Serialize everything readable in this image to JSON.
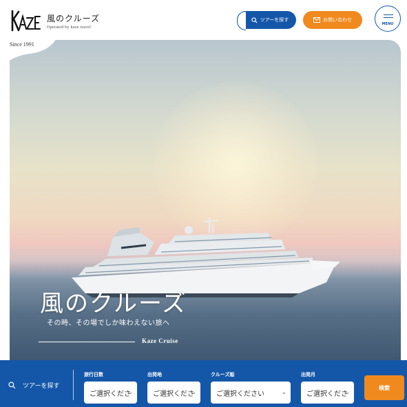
{
  "header": {
    "logo_title": "風のクルーズ",
    "logo_subtitle": "Operated by kaze travel",
    "search_button": "ツアーを探す",
    "inquiry_button": "お問い合わせ",
    "menu_button": "MENU",
    "since": "Since 1991"
  },
  "hero": {
    "title": "風のクルーズ",
    "subtitle": "その時、その場でしか味わえない旅へ",
    "tagline": "Kaze Cruise"
  },
  "search": {
    "label": "ツアーを探す",
    "fields": [
      {
        "label": "旅行日数",
        "value": "ご選択くださ"
      },
      {
        "label": "出発地",
        "value": "ご選択くださ"
      },
      {
        "label": "クルーズ船",
        "value": "ご選択ください"
      },
      {
        "label": "出発月",
        "value": "ご選択くださ"
      }
    ],
    "submit": "検索"
  },
  "colors": {
    "primary": "#1457a8",
    "accent": "#f08a1e"
  }
}
